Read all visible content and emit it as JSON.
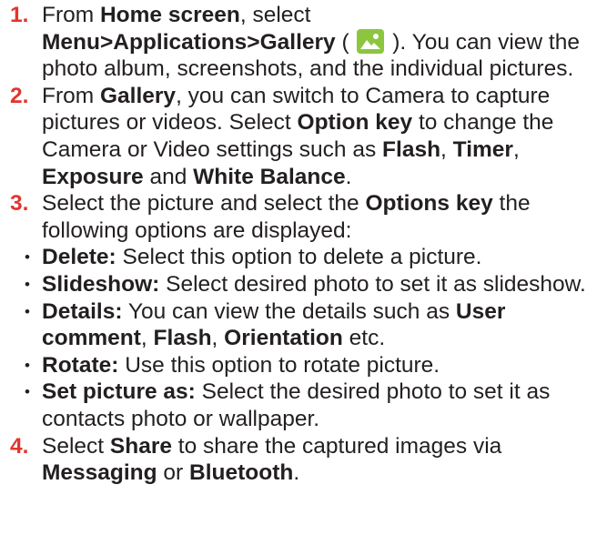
{
  "steps": [
    {
      "number": "1.",
      "parts": [
        "From ",
        "Home screen",
        ", select",
        "Menu>Applications>Gallery",
        " ( ",
        " ). You can view the photo album, screenshots, and the individual pictures."
      ]
    },
    {
      "number": "2.",
      "parts": [
        "From ",
        "Gallery",
        ", you can switch to Camera to capture pictures or videos. Select ",
        "Option key",
        " to change the Camera or Video settings such as ",
        "Flash",
        ", ",
        "Timer",
        ", ",
        "Exposure",
        " and ",
        "White Balance",
        "."
      ]
    },
    {
      "number": "3.",
      "parts": [
        "Select the picture and select the ",
        "Options key",
        " the following options are displayed:"
      ],
      "options": [
        {
          "term": "Delete:",
          "text": " Select this option to delete a picture."
        },
        {
          "term": "Slideshow:",
          "text": " Select desired photo to set it as slideshow."
        },
        {
          "term": "Details:",
          "text": " You can view the details such as ",
          "extra": [
            "User comment",
            ", ",
            "Flash",
            ", ",
            "Orientation",
            " etc."
          ]
        },
        {
          "term": "Rotate:",
          "text": " Use this option to rotate picture."
        },
        {
          "term": "Set picture as:",
          "text": " Select the desired photo to set it as contacts photo or wallpaper."
        }
      ]
    },
    {
      "number": "4.",
      "parts": [
        "Select ",
        "Share",
        " to share the captured images via ",
        "Messaging",
        " or ",
        "Bluetooth",
        "."
      ]
    }
  ],
  "icons": {
    "gallery": "gallery-icon",
    "gallery_color": "#8cc63f"
  },
  "colors": {
    "step_number": "#e2352d",
    "text": "#231f20"
  }
}
